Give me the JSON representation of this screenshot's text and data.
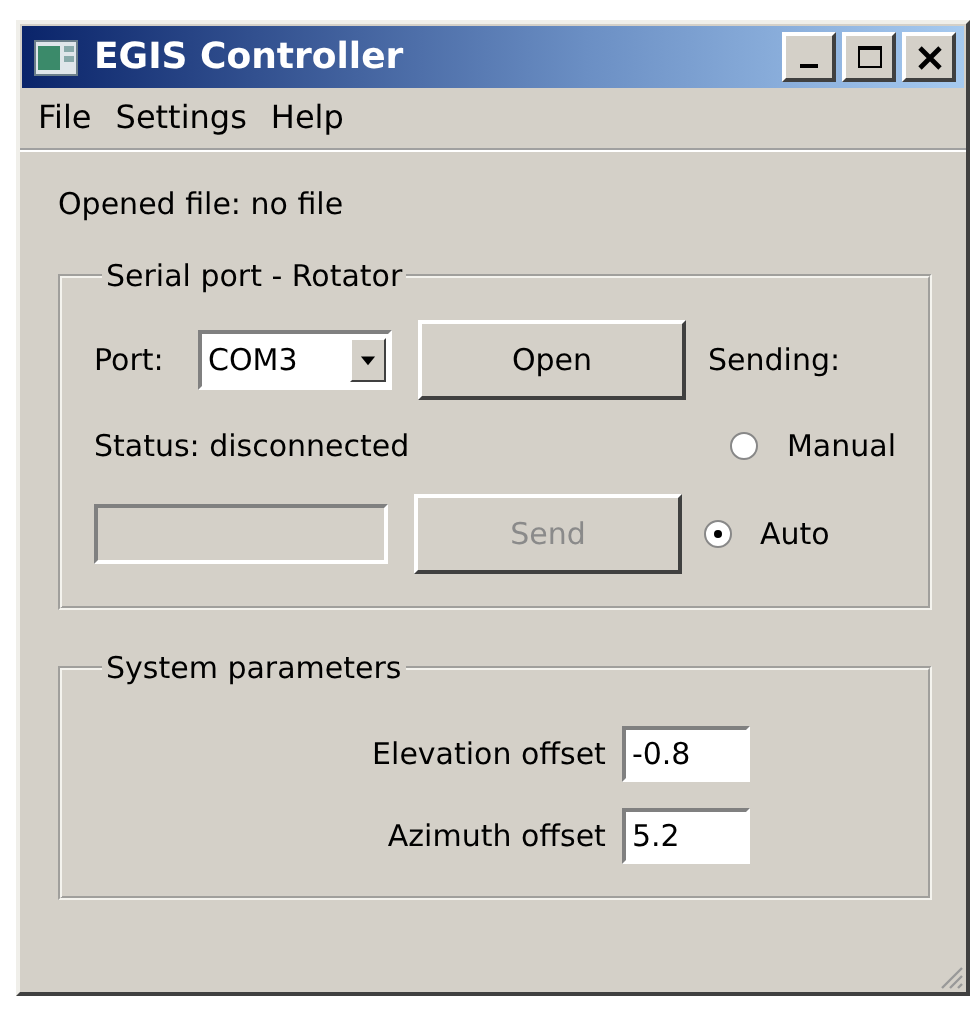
{
  "window": {
    "title": "EGIS Controller"
  },
  "menu": [
    {
      "label": "File"
    },
    {
      "label": "Settings"
    },
    {
      "label": "Help"
    }
  ],
  "opened_file": "Opened file: no file",
  "serial_group": {
    "title": "Serial port - Rotator",
    "port_label": "Port:",
    "port_value": "COM3",
    "open_button": {
      "label": "Open",
      "disabled": false
    },
    "sending_label": "Sending:",
    "status": "Status: disconnected",
    "command_field": {
      "disabled": true
    },
    "send_button": {
      "label": "Send",
      "disabled": true
    },
    "sending_modes": [
      {
        "label": "Manual",
        "selected": false
      },
      {
        "label": "Auto",
        "selected": true
      }
    ]
  },
  "system_group": {
    "title": "System parameters",
    "params": [
      {
        "label": "Elevation offset",
        "value": "-0.8"
      },
      {
        "label": "Azimuth offset",
        "value": "5.2"
      }
    ]
  }
}
